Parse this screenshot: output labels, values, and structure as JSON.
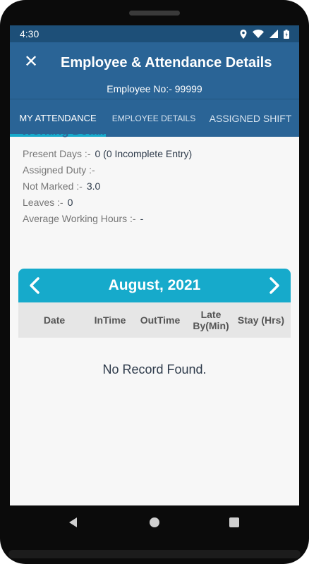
{
  "status_bar": {
    "time": "4:30",
    "icons": [
      "location-icon",
      "wifi-icon",
      "signal-icon",
      "battery-icon"
    ]
  },
  "app_bar": {
    "close_icon": "close-icon",
    "title": "Employee & Attendance Details",
    "employee_no": "Employee No:- 99999"
  },
  "tabs": [
    {
      "label": "MY ATTENDANCE",
      "selected": true
    },
    {
      "label": "EMPLOYEE DETAILS",
      "selected": false
    },
    {
      "label": "ASSIGNED SHIFT",
      "selected": false
    }
  ],
  "working_details": {
    "title": "Working Details",
    "rows": [
      {
        "label": "Present Days :-",
        "value": "0 (0 Incomplete Entry)"
      },
      {
        "label": "Assigned Duty :-",
        "value": ""
      },
      {
        "label": "Not Marked :-",
        "value": "3.0"
      },
      {
        "label": "Leaves :-",
        "value": "0"
      },
      {
        "label": "Average Working Hours :-",
        "value": "-"
      }
    ]
  },
  "calendar": {
    "month": "August, 2021",
    "prev_icon": "chevron-left-icon",
    "next_icon": "chevron-right-icon",
    "columns": [
      "Date",
      "InTime",
      "OutTime",
      "Late By(Min)",
      "Stay (Hrs)"
    ],
    "empty_message": "No Record Found."
  },
  "colors": {
    "primary": "#2a6496",
    "status_bar": "#1d4f78",
    "accent": "#16aacb",
    "header_row": "#e6e6e6"
  },
  "system_nav": [
    "back-icon",
    "home-icon",
    "recents-icon"
  ]
}
